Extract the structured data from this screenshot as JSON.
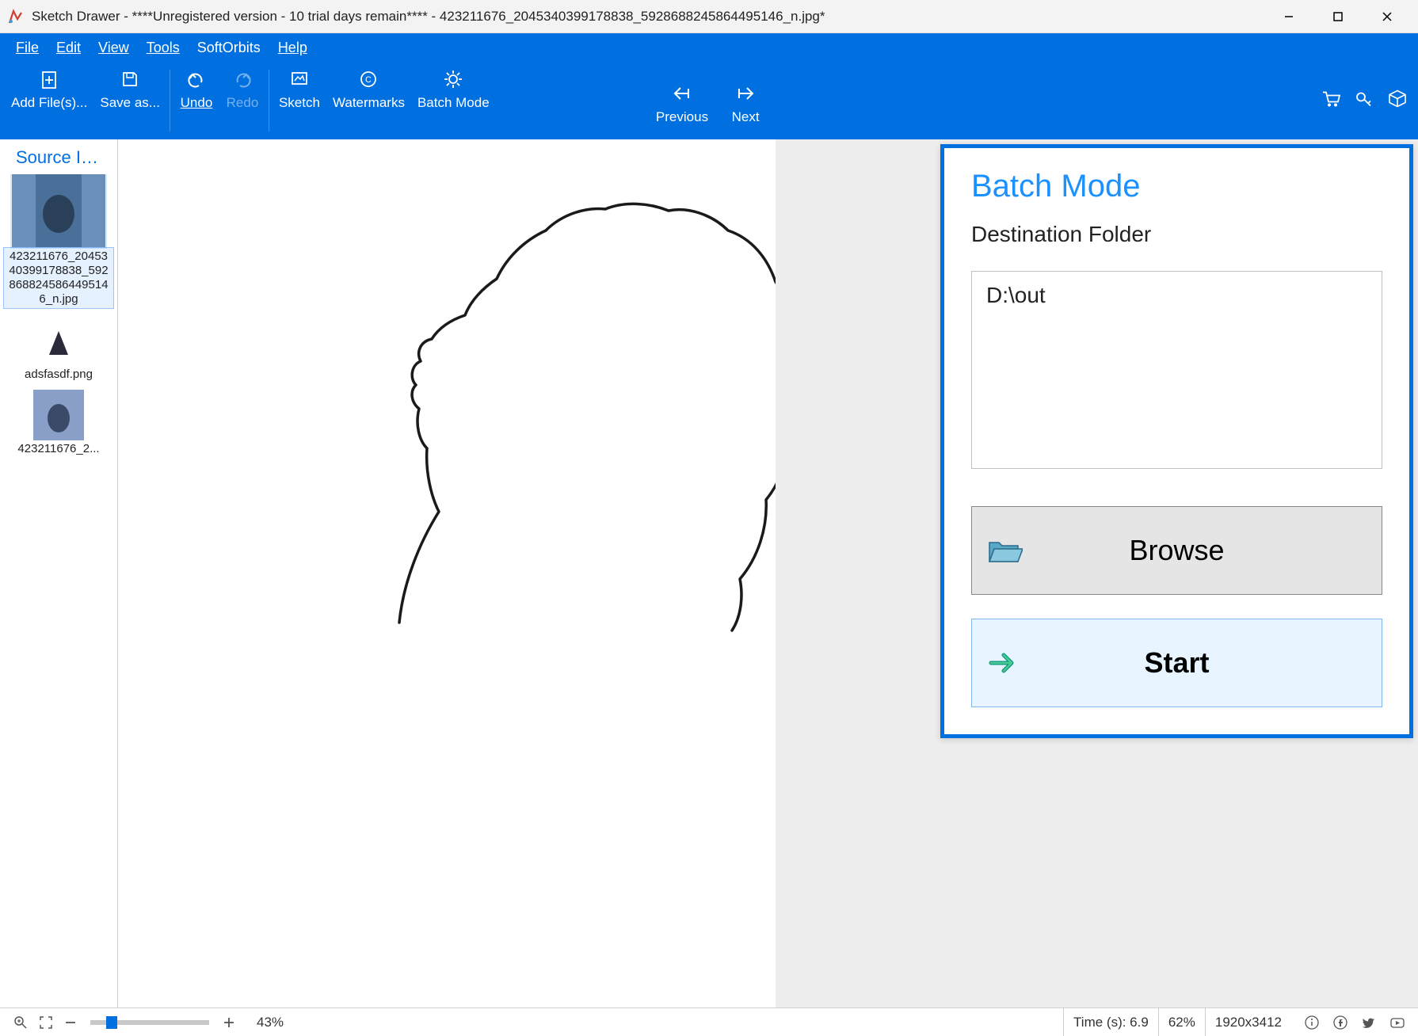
{
  "window": {
    "title": "Sketch Drawer - ****Unregistered version - 10 trial days remain**** - 423211676_2045340399178838_5928688245864495146_n.jpg*"
  },
  "menubar": {
    "file": "File",
    "edit": "Edit",
    "view": "View",
    "tools": "Tools",
    "softorbits": "SoftOrbits",
    "help": "Help"
  },
  "toolbar": {
    "add_files": "Add File(s)...",
    "save_as": "Save as...",
    "undo": "Undo",
    "redo": "Redo",
    "sketch": "Sketch",
    "watermarks": "Watermarks",
    "batch_mode": "Batch Mode",
    "previous": "Previous",
    "next": "Next"
  },
  "sidebar": {
    "title": "Source Im...",
    "thumbs": [
      {
        "filename": "423211676_2045340399178838_5928688245864495146_n.jpg",
        "selected": true
      },
      {
        "filename": "adsfasdf.png",
        "selected": false
      },
      {
        "filename": "423211676_2...",
        "selected": false
      }
    ]
  },
  "panel": {
    "title": "Batch Mode",
    "dest_label": "Destination Folder",
    "dest_value": "D:\\out",
    "browse": "Browse",
    "start": "Start"
  },
  "status": {
    "zoom": "43%",
    "time": "Time (s): 6.9",
    "percent": "62%",
    "dimensions": "1920x3412"
  }
}
